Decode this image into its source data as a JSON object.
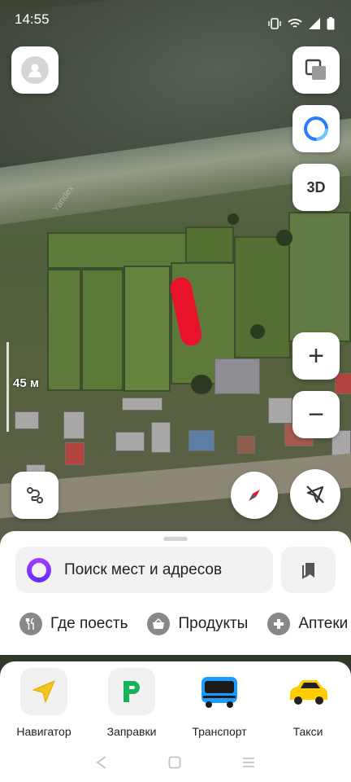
{
  "status_bar": {
    "time": "14:55",
    "icons": [
      "vibrate-icon",
      "wifi-icon",
      "signal-icon",
      "battery-icon"
    ]
  },
  "map": {
    "watermark": "Yandex",
    "scale_label": "45 м",
    "marker_color": "#e8122a"
  },
  "controls": {
    "avatar": "avatar-icon",
    "layers": "layers-icon",
    "alice": "alice-icon",
    "mode_3d_label": "3D",
    "zoom_in_label": "+",
    "zoom_out_label": "−",
    "route": "route-icon",
    "compass": "compass-icon",
    "location": "location-off-icon"
  },
  "search": {
    "placeholder": "Поиск мест и адресов"
  },
  "categories": [
    {
      "label": "Где поесть",
      "icon": "fork-knife-icon"
    },
    {
      "label": "Продукты",
      "icon": "basket-icon"
    },
    {
      "label": "Аптеки",
      "icon": "pharmacy-cross-icon"
    }
  ],
  "services": [
    {
      "label": "Навигатор",
      "icon": "navigator-arrow-icon"
    },
    {
      "label": "Заправки",
      "icon": "fuel-icon"
    },
    {
      "label": "Транспорт",
      "icon": "bus-icon"
    },
    {
      "label": "Такси",
      "icon": "taxi-car-icon"
    }
  ],
  "colors": {
    "accent_alice": "#7b2cff",
    "navigator_yellow": "#f5c518",
    "fuel_green": "#16b35a",
    "taxi_yellow": "#ffcc00"
  }
}
